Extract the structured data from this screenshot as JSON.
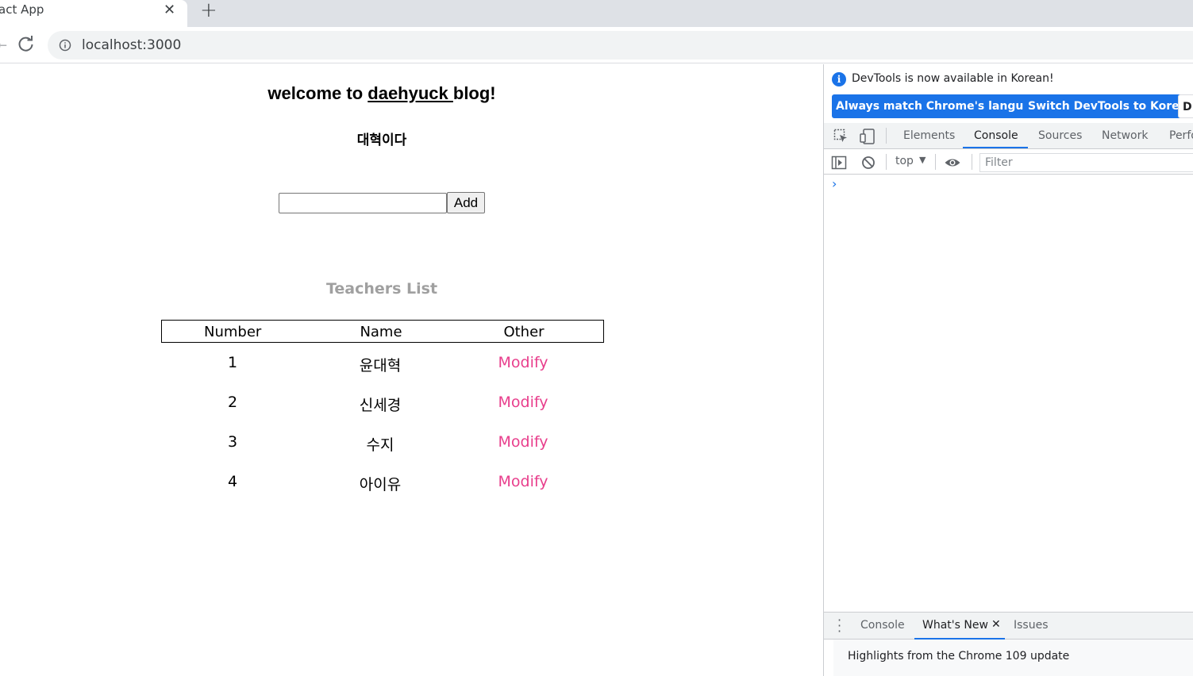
{
  "browser": {
    "tab_title": "act App",
    "tab_close": "✕",
    "new_tab": "+",
    "url": "localhost:3000"
  },
  "page": {
    "title_prefix": "welcome to ",
    "title_link": "daehyuck ",
    "title_suffix": "blog!",
    "subtitle": "대혁이다",
    "input_value": "",
    "add_label": "Add",
    "list_title": "Teachers List",
    "table": {
      "headers": [
        "Number",
        "Name",
        "Other"
      ],
      "rows": [
        {
          "number": "1",
          "name": "윤대혁",
          "action": "Modify"
        },
        {
          "number": "2",
          "name": "신세경",
          "action": "Modify"
        },
        {
          "number": "3",
          "name": "수지",
          "action": "Modify"
        },
        {
          "number": "4",
          "name": "아이유",
          "action": "Modify"
        }
      ]
    }
  },
  "devtools": {
    "notice": "DevTools is now available in Korean!",
    "btn_match": "Always match Chrome's language",
    "btn_switch": "Switch DevTools to Korean",
    "btn_dont": "D",
    "tabs": [
      "Elements",
      "Console",
      "Sources",
      "Network",
      "Perfo"
    ],
    "context": "top",
    "filter_placeholder": "Filter",
    "prompt": "›",
    "drawer_tabs": [
      "Console",
      "What's New",
      "Issues"
    ],
    "drawer_close": "✕",
    "whats_new_text": "Highlights from the Chrome 109 update"
  },
  "colors": {
    "modify": "#e83e8c",
    "accent": "#1a73e8"
  }
}
